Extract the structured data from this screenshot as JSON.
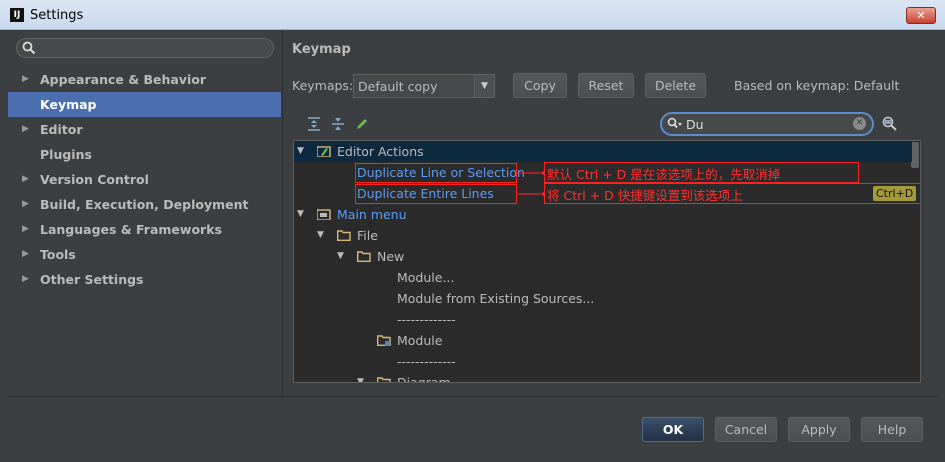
{
  "window": {
    "title": "Settings",
    "app_icon": "IJ"
  },
  "search": {
    "placeholder": ""
  },
  "sidebar": {
    "items": [
      {
        "label": "Appearance & Behavior",
        "expandable": true
      },
      {
        "label": "Keymap",
        "expandable": false,
        "selected": true
      },
      {
        "label": "Editor",
        "expandable": true
      },
      {
        "label": "Plugins",
        "expandable": false
      },
      {
        "label": "Version Control",
        "expandable": true
      },
      {
        "label": "Build, Execution, Deployment",
        "expandable": true
      },
      {
        "label": "Languages & Frameworks",
        "expandable": true
      },
      {
        "label": "Tools",
        "expandable": true
      },
      {
        "label": "Other Settings",
        "expandable": true
      }
    ]
  },
  "main": {
    "heading": "Keymap",
    "keymaps_label": "Keymaps:",
    "keymap_value": "Default copy",
    "copy_label": "Copy",
    "reset_label": "Reset",
    "delete_label": "Delete",
    "based_on": "Based on keymap: Default",
    "filter_value": "Du"
  },
  "tree": {
    "rows": [
      "Editor Actions",
      "Duplicate Line or Selection",
      "Duplicate Entire Lines",
      "Main menu",
      "File",
      "New",
      "Module...",
      "Module from Existing Sources...",
      "-------------",
      "Module",
      "-------------",
      "Diagram"
    ],
    "shortcut": "Ctrl+D",
    "annotation_1": "默认 Ctrl + D 是在该选项上的，先取消掉",
    "annotation_2": "将 Ctrl + D 快捷键设置到该选项上"
  },
  "footer": {
    "ok": "OK",
    "cancel": "Cancel",
    "apply": "Apply",
    "help": "Help"
  },
  "colors": {
    "selection": "#4b6eaf",
    "link": "#589df6",
    "annotation": "#ff3030",
    "shortcut_bg": "#a49a3c"
  }
}
